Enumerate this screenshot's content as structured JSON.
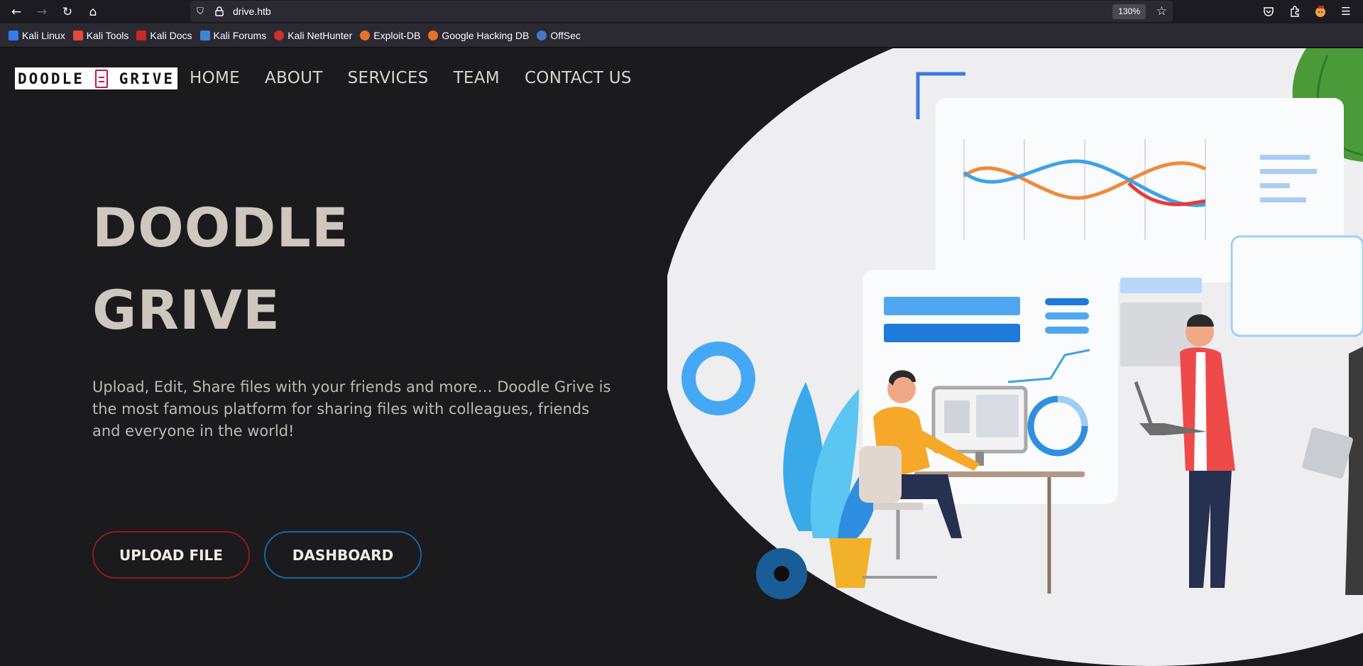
{
  "browser": {
    "url": "drive.htb",
    "zoom": "130%",
    "icons": [
      "back-arrow-icon",
      "forward-arrow-icon",
      "reload-icon",
      "home-icon",
      "shield-icon",
      "lock-icon",
      "star-icon",
      "pocket-icon",
      "extensions-icon",
      "profile-icon",
      "menu-icon"
    ]
  },
  "bookmarks": [
    {
      "label": "Kali Linux",
      "color": "#367bf0"
    },
    {
      "label": "Kali Tools",
      "color": "#e04b3a"
    },
    {
      "label": "Kali Docs",
      "color": "#c62828"
    },
    {
      "label": "Kali Forums",
      "color": "#3f83d6"
    },
    {
      "label": "Kali NetHunter",
      "color": "#d32f2f"
    },
    {
      "label": "Exploit-DB",
      "color": "#e8712a"
    },
    {
      "label": "Google Hacking DB",
      "color": "#e8712a"
    },
    {
      "label": "OffSec",
      "color": "#4a76c9"
    }
  ],
  "site": {
    "logo_left": "DOODLE",
    "logo_right": "GRIVE",
    "nav": [
      "HOME",
      "ABOUT",
      "SERVICES",
      "TEAM",
      "CONTACT US"
    ],
    "hero_line1": "DOODLE",
    "hero_line2": "GRIVE",
    "hero_text": "Upload, Edit, Share files with your friends and more… Doodle Grive is the most famous platform for sharing files with colleagues, friends and everyone in the world!",
    "btn_upload": "UPLOAD FILE",
    "btn_dashboard": "DASHBOARD"
  },
  "colors": {
    "accent_red": "#8d1d1d",
    "accent_blue": "#1566a8",
    "bg": "#1b1b1d"
  }
}
